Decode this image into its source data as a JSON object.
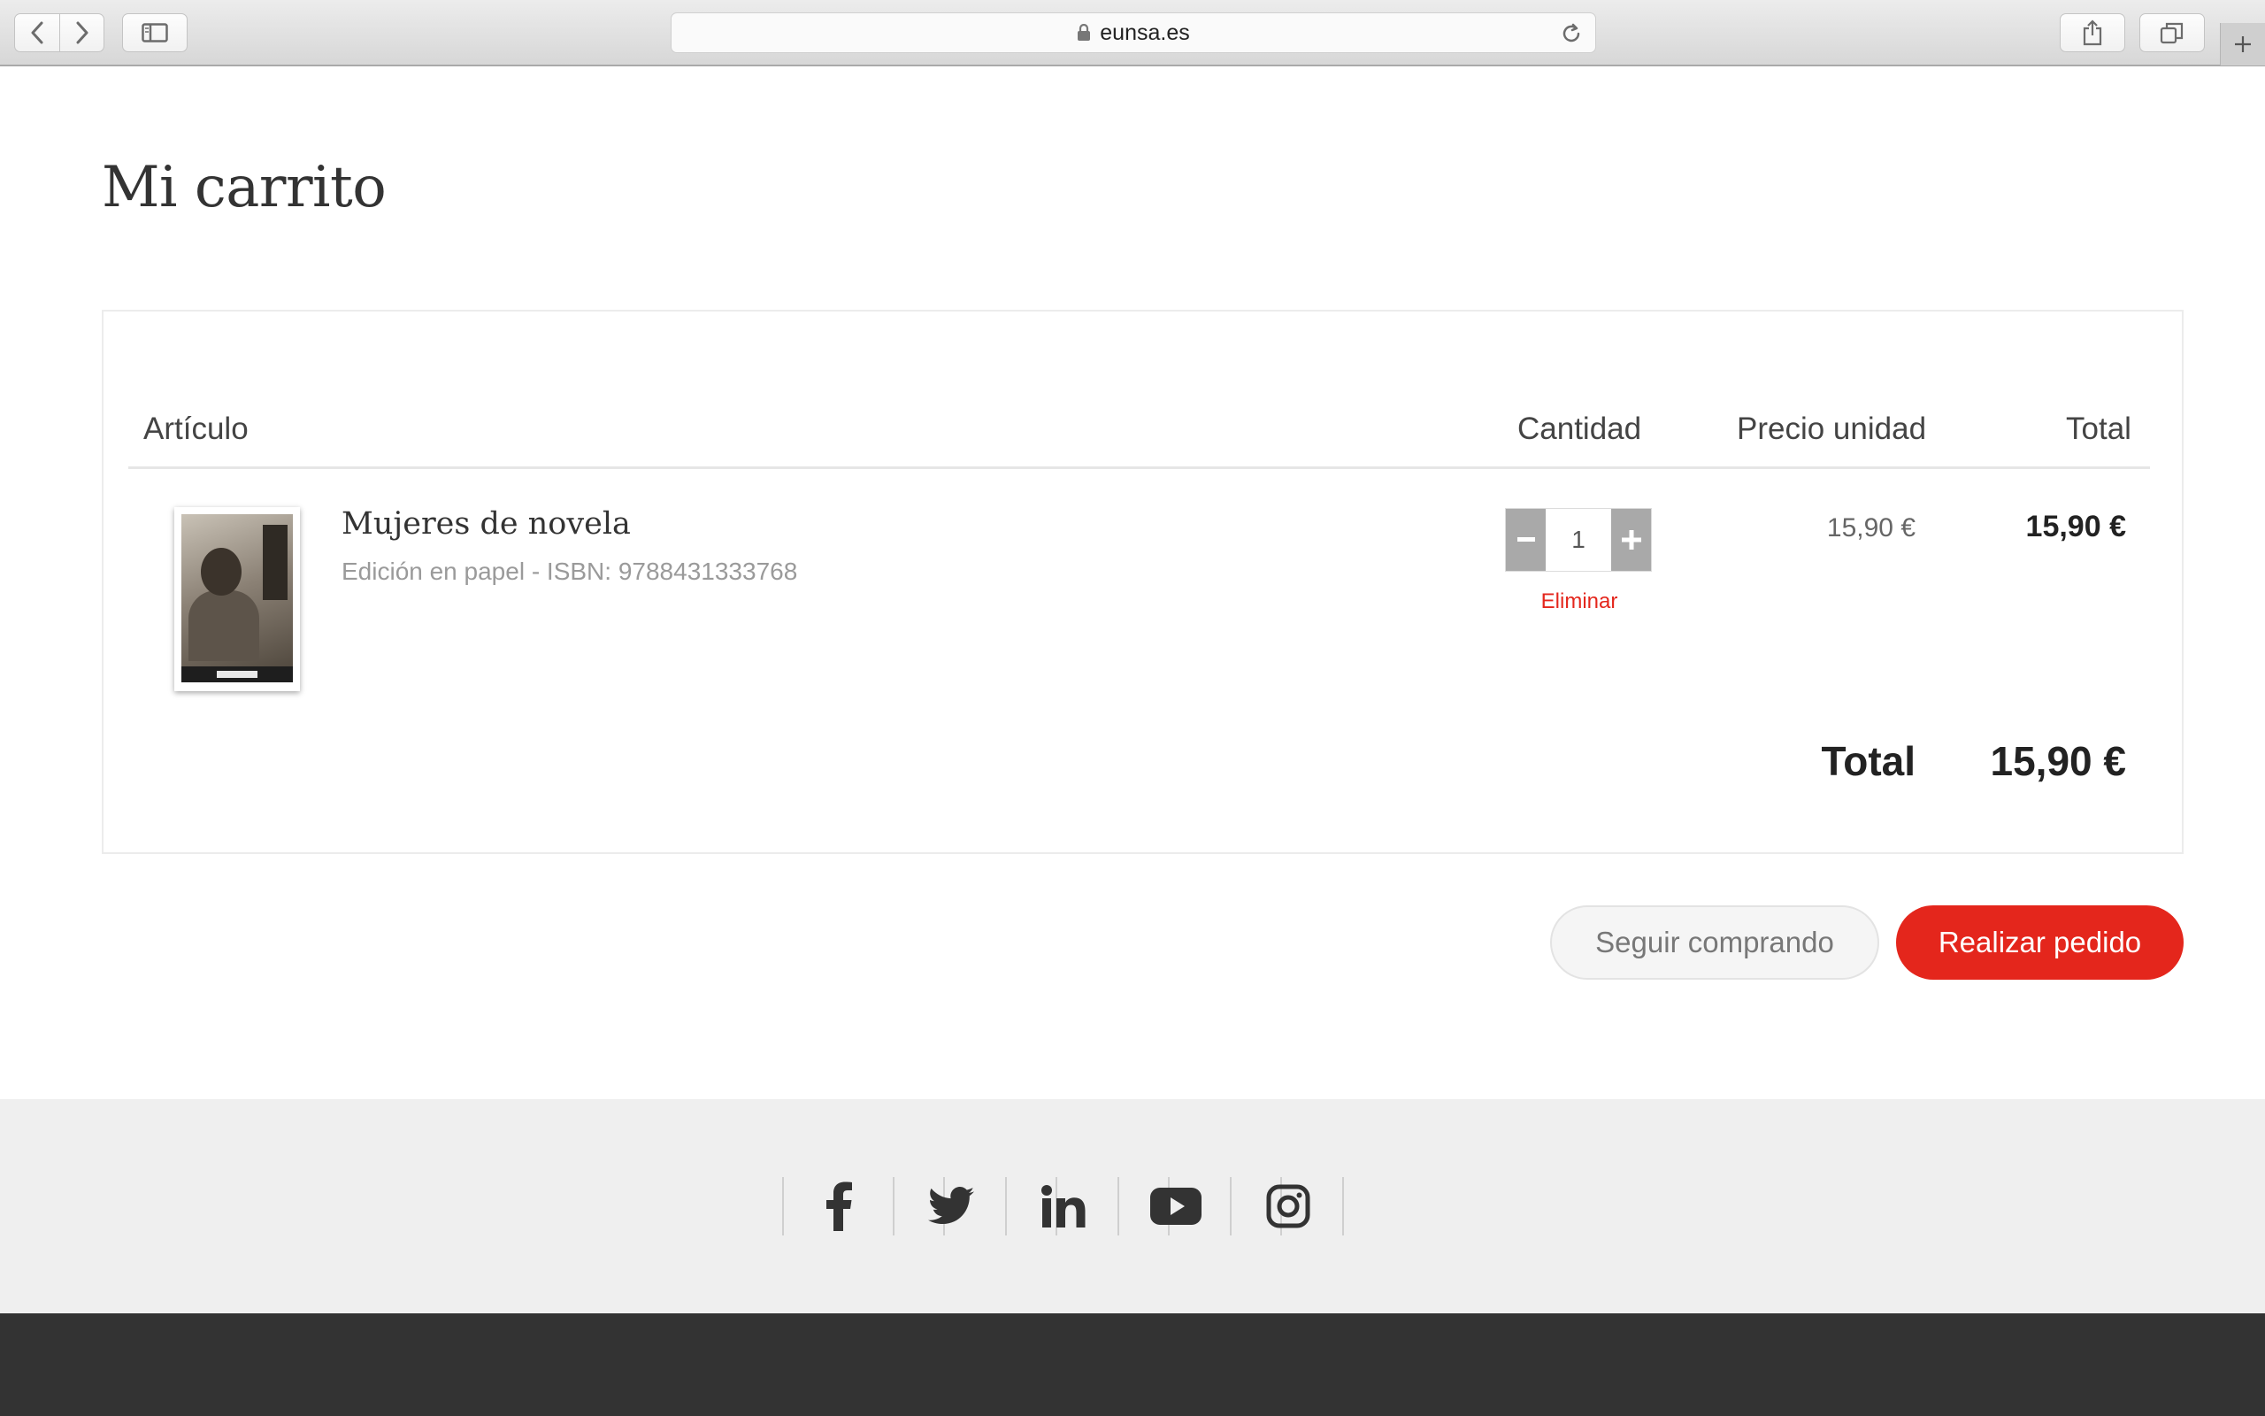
{
  "browser": {
    "url": "eunsa.es"
  },
  "page": {
    "title": "Mi carrito"
  },
  "cart": {
    "headers": {
      "article": "Artículo",
      "quantity": "Cantidad",
      "unit_price": "Precio unidad",
      "total": "Total"
    },
    "items": [
      {
        "title": "Mujeres de novela",
        "meta": "Edición en papel - ISBN: 9788431333768",
        "quantity": "1",
        "remove_label": "Eliminar",
        "unit_price": "15,90 €",
        "line_total": "15,90 €"
      }
    ],
    "grand_total_label": "Total",
    "grand_total_value": "15,90 €"
  },
  "actions": {
    "continue_label": "Seguir comprando",
    "order_label": "Realizar pedido"
  },
  "footer": {
    "social": [
      "facebook-icon",
      "twitter-icon",
      "linkedin-icon",
      "youtube-icon",
      "instagram-icon"
    ]
  },
  "colors": {
    "accent": "#e4261c",
    "footer_bg": "#efefef",
    "bottom_bar": "#333333"
  }
}
